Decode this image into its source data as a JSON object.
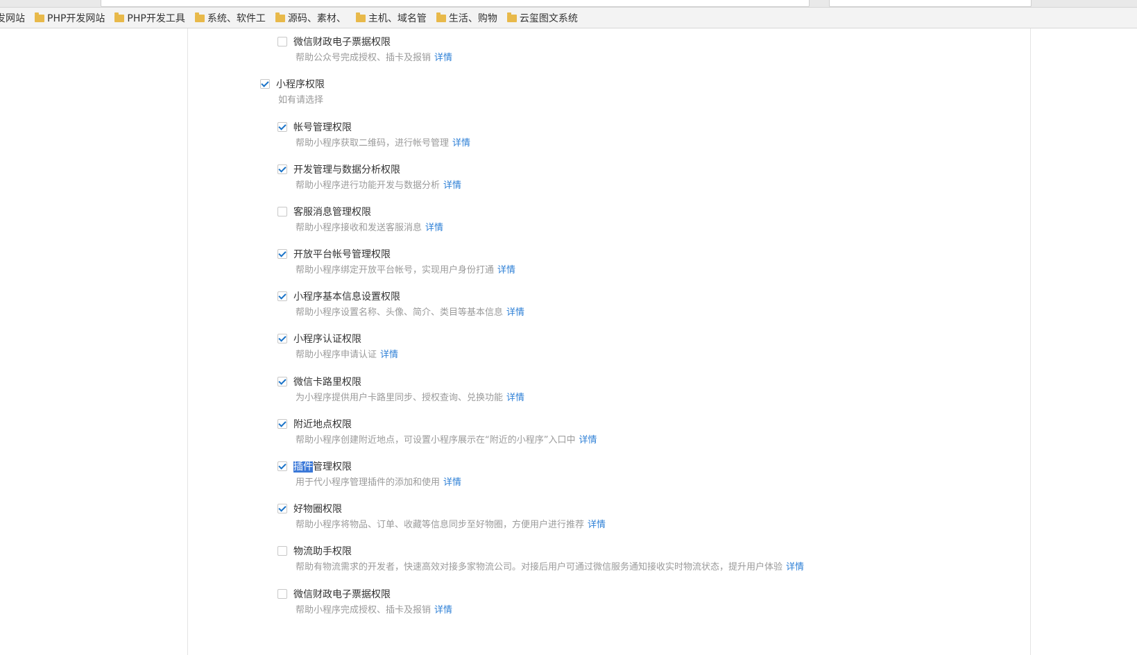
{
  "bookmarks": [
    {
      "label": "发网站",
      "folder": false
    },
    {
      "label": "PHP开发网站",
      "folder": true
    },
    {
      "label": "PHP开发工具",
      "folder": true
    },
    {
      "label": "系统、软件工",
      "folder": true
    },
    {
      "label": "源码、素材、",
      "folder": true
    },
    {
      "label": "主机、域名管",
      "folder": true
    },
    {
      "label": "生活、购物",
      "folder": true
    },
    {
      "label": "云玺图文系统",
      "folder": true
    }
  ],
  "colors": {
    "accent": "#2d7fd6",
    "check": "#1a73c8",
    "highlight": "#3a78d8"
  },
  "top_item": {
    "title": "微信财政电子票据权限",
    "desc": "帮助公众号完成授权、插卡及报销",
    "link": "详情",
    "checked": false
  },
  "mini_program": {
    "title": "小程序权限",
    "hint": "如有请选择",
    "checked": true,
    "items": [
      {
        "title": "帐号管理权限",
        "desc": "帮助小程序获取二维码，进行帐号管理",
        "link": "详情",
        "checked": true
      },
      {
        "title": "开发管理与数据分析权限",
        "desc": "帮助小程序进行功能开发与数据分析",
        "link": "详情",
        "checked": true
      },
      {
        "title": "客服消息管理权限",
        "desc": "帮助小程序接收和发送客服消息",
        "link": "详情",
        "checked": false
      },
      {
        "title": "开放平台帐号管理权限",
        "desc": "帮助小程序绑定开放平台帐号，实现用户身份打通",
        "link": "详情",
        "checked": true
      },
      {
        "title": "小程序基本信息设置权限",
        "desc": "帮助小程序设置名称、头像、简介、类目等基本信息",
        "link": "详情",
        "checked": true
      },
      {
        "title": "小程序认证权限",
        "desc": "帮助小程序申请认证",
        "link": "详情",
        "checked": true
      },
      {
        "title": "微信卡路里权限",
        "desc": "为小程序提供用户卡路里同步、授权查询、兑换功能",
        "link": "详情",
        "checked": true
      },
      {
        "title": "附近地点权限",
        "desc": "帮助小程序创建附近地点，可设置小程序展示在“附近的小程序”入口中",
        "link": "详情",
        "checked": true
      },
      {
        "title_highlight": "插件",
        "title_rest": "管理权限",
        "desc": "用于代小程序管理插件的添加和使用",
        "link": "详情",
        "checked": true
      },
      {
        "title": "好物圈权限",
        "desc": "帮助小程序将物品、订单、收藏等信息同步至好物圈，方便用户进行推荐",
        "link": "详情",
        "checked": true
      },
      {
        "title": "物流助手权限",
        "desc": "帮助有物流需求的开发者，快速高效对接多家物流公司。对接后用户可通过微信服务通知接收实时物流状态，提升用户体验",
        "link": "详情",
        "checked": false
      },
      {
        "title": "微信财政电子票据权限",
        "desc": "帮助小程序完成授权、插卡及报销",
        "link": "详情",
        "checked": false
      }
    ]
  }
}
